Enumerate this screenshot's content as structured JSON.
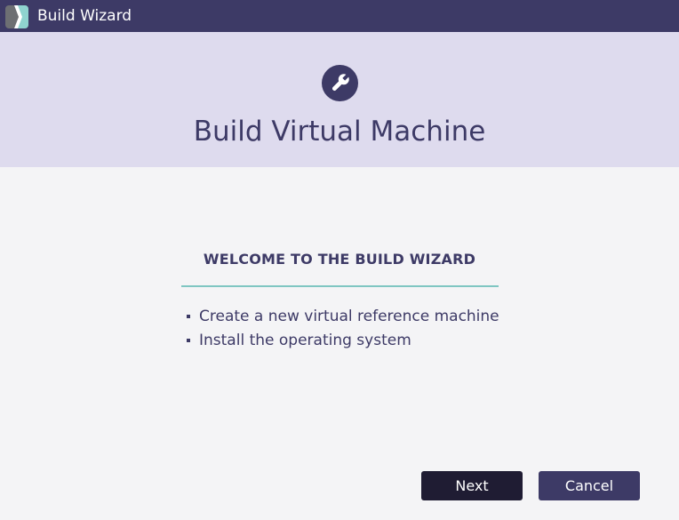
{
  "window": {
    "title": "Build Wizard",
    "app_icon": "app-logo-icon"
  },
  "header": {
    "icon": "wrench-icon",
    "title": "Build Virtual Machine"
  },
  "content": {
    "heading": "WELCOME TO THE BUILD WIZARD",
    "items": [
      "Create a new virtual reference machine",
      "Install the operating system"
    ]
  },
  "buttons": {
    "next_label": "Next",
    "cancel_label": "Cancel"
  },
  "colors": {
    "titlebar": "#3d3a66",
    "header_band": "#dedbee",
    "accent_line": "#7fc6c2",
    "primary_dark": "#1f1c33",
    "text": "#3d3a66",
    "background": "#f4f4f6"
  }
}
